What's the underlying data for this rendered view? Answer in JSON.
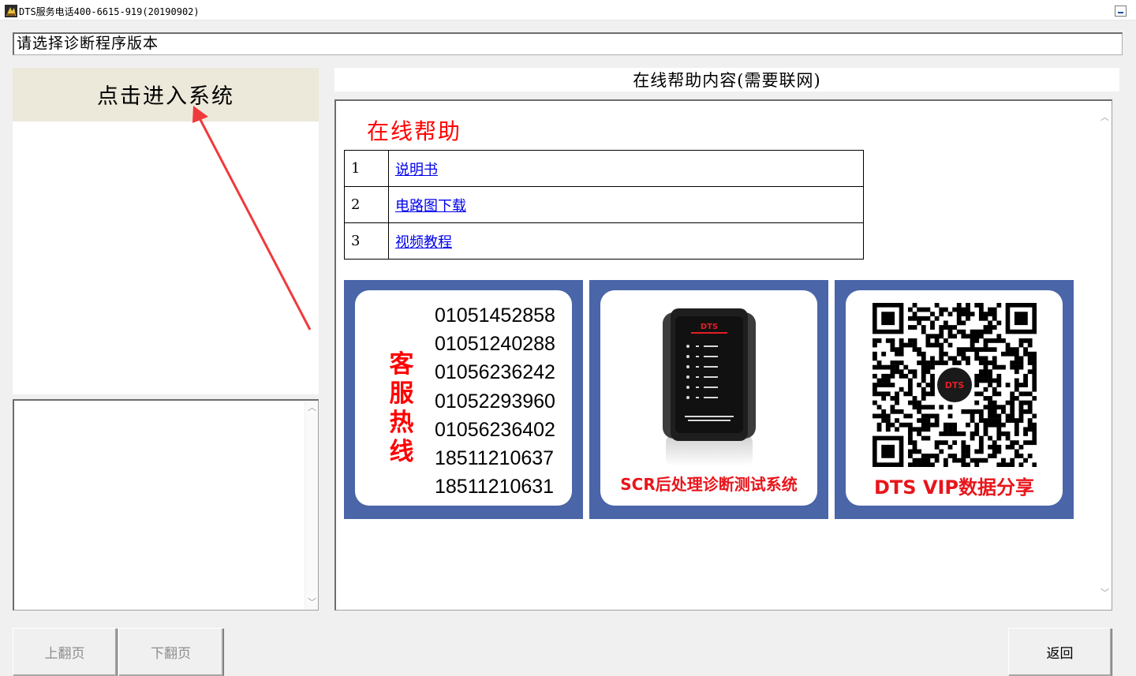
{
  "window": {
    "title": "DTS服务电话400-6615-919(20190902)",
    "app_icon": "dts-app-icon",
    "minimize_icon": "minimize-icon"
  },
  "version_field": {
    "value": "请选择诊断程序版本"
  },
  "left_panel": {
    "enter_button": "点击进入系统",
    "arrow_color": "#f0393b"
  },
  "help": {
    "header": "在线帮助内容(需要联网)",
    "heading": "在线帮助",
    "rows": [
      {
        "num": "1",
        "label": "说明书"
      },
      {
        "num": "2",
        "label": "电路图下载"
      },
      {
        "num": "3",
        "label": "视频教程"
      }
    ]
  },
  "banners": {
    "hotline": {
      "label": "客服热线",
      "label_chars": [
        "客",
        "服",
        "热",
        "线"
      ],
      "phones": [
        "01051452858",
        "01051240288",
        "01056236242",
        "01052293960",
        "01056236402",
        "18511210637",
        "18511210631"
      ]
    },
    "device": {
      "caption": "SCR后处理诊断测试系统",
      "logo_text": "DTS"
    },
    "vip": {
      "caption": "DTS VIP数据分享"
    },
    "frame_color": "#4a65a8",
    "caption_color": "#e8151b"
  },
  "buttons": {
    "prev_page": "上翻页",
    "next_page": "下翻页",
    "back": "返回"
  }
}
